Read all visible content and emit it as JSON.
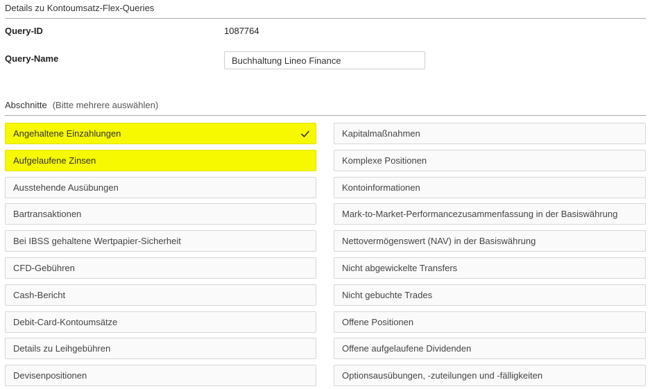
{
  "panel": {
    "title": "Details zu Kontoumsatz-Flex-Queries"
  },
  "query_id": {
    "label": "Query-ID",
    "value": "1087764"
  },
  "query_name": {
    "label": "Query-Name",
    "value": "Buchhaltung Lineo Finance"
  },
  "sections": {
    "heading": "Abschnitte",
    "hint": "(Bitte mehrere auswählen)",
    "left": [
      {
        "label": "Angehaltene Einzahlungen",
        "selected": true,
        "checkmark": true
      },
      {
        "label": "Aufgelaufene Zinsen",
        "selected": true,
        "checkmark": false
      },
      {
        "label": "Ausstehende Ausübungen",
        "selected": false,
        "checkmark": false
      },
      {
        "label": "Bartransaktionen",
        "selected": false,
        "checkmark": false
      },
      {
        "label": "Bei IBSS gehaltene Wertpapier-Sicherheit",
        "selected": false,
        "checkmark": false
      },
      {
        "label": "CFD-Gebühren",
        "selected": false,
        "checkmark": false
      },
      {
        "label": "Cash-Bericht",
        "selected": false,
        "checkmark": false
      },
      {
        "label": "Debit-Card-Kontoumsätze",
        "selected": false,
        "checkmark": false
      },
      {
        "label": "Details zu Leihgebühren",
        "selected": false,
        "checkmark": false
      },
      {
        "label": "Devisenpositionen",
        "selected": false,
        "checkmark": false
      }
    ],
    "right": [
      {
        "label": "Kapitalmaßnahmen",
        "selected": false,
        "checkmark": false
      },
      {
        "label": "Komplexe Positionen",
        "selected": false,
        "checkmark": false
      },
      {
        "label": "Kontoinformationen",
        "selected": false,
        "checkmark": false
      },
      {
        "label": "Mark-to-Market-Performancezusammenfassung in der Basiswährung",
        "selected": false,
        "checkmark": false
      },
      {
        "label": "Nettovermögenswert (NAV) in der Basiswährung",
        "selected": false,
        "checkmark": false
      },
      {
        "label": "Nicht abgewickelte Transfers",
        "selected": false,
        "checkmark": false
      },
      {
        "label": "Nicht gebuchte Trades",
        "selected": false,
        "checkmark": false
      },
      {
        "label": "Offene Positionen",
        "selected": false,
        "checkmark": false
      },
      {
        "label": "Offene aufgelaufene Dividenden",
        "selected": false,
        "checkmark": false
      },
      {
        "label": "Optionsausübungen, -zuteilungen und -fälligkeiten",
        "selected": false,
        "checkmark": false
      }
    ]
  },
  "icons": {
    "check": "checkmark-icon"
  },
  "colors": {
    "selected_background": "#f7f900",
    "option_background": "#fafafa",
    "option_border": "#d6d6d6",
    "divider": "#a9a9a9"
  }
}
